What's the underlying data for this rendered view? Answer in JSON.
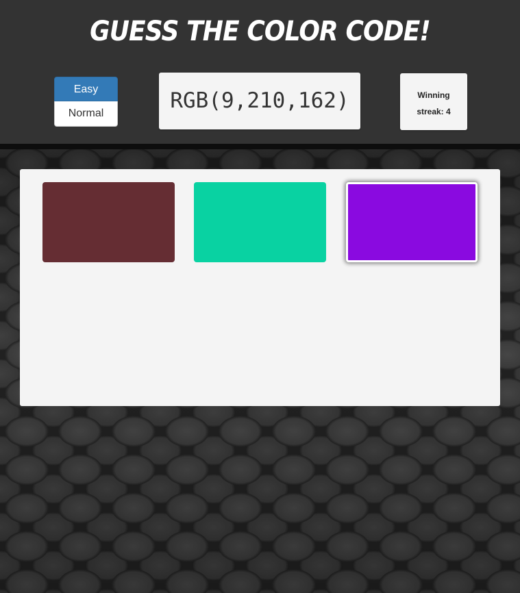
{
  "header": {
    "title": "Guess the color code!",
    "background": "#333333"
  },
  "difficulty": {
    "options": [
      {
        "label": "Easy",
        "selected": true
      },
      {
        "label": "Normal",
        "selected": false
      }
    ],
    "accent": "#337ab7"
  },
  "target": {
    "label": "RGB(9,210,162)"
  },
  "streak": {
    "line1": "Winning",
    "line2": "streak: 4"
  },
  "swatches": [
    {
      "color": "#652d33",
      "selected": false
    },
    {
      "color": "#09d2a2",
      "selected": false
    },
    {
      "color": "#8a0ae0",
      "selected": true
    }
  ]
}
